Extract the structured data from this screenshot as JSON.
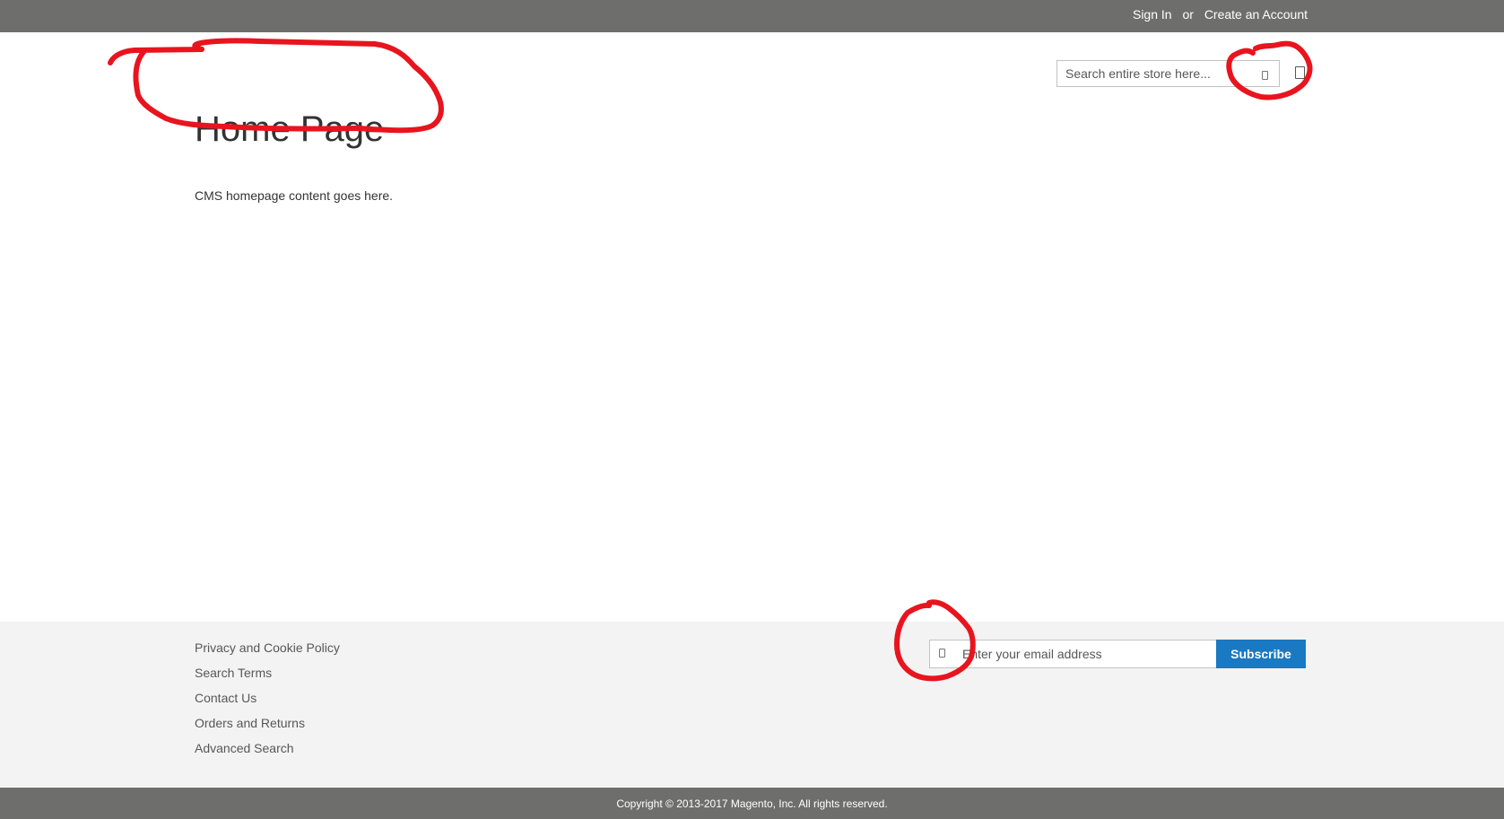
{
  "header": {
    "sign_in": "Sign In",
    "or_text": "or",
    "create_account": "Create an Account"
  },
  "search": {
    "placeholder": "Search entire store here..."
  },
  "page": {
    "title": "Home Page",
    "content": "CMS homepage content goes here."
  },
  "footer": {
    "links": [
      "Privacy and Cookie Policy",
      "Search Terms",
      "Contact Us",
      "Orders and Returns",
      "Advanced Search"
    ],
    "newsletter": {
      "placeholder": "Enter your email address",
      "button": "Subscribe"
    },
    "copyright": "Copyright © 2013-2017 Magento, Inc. All rights reserved."
  },
  "colors": {
    "bar": "#6e6f6d",
    "footer_bg": "#f3f3f3",
    "primary_button": "#1979c3",
    "annotation": "#e8141e"
  },
  "icons": {
    "search": "search-icon",
    "cart": "cart-icon",
    "newsletter": "envelope-icon"
  }
}
